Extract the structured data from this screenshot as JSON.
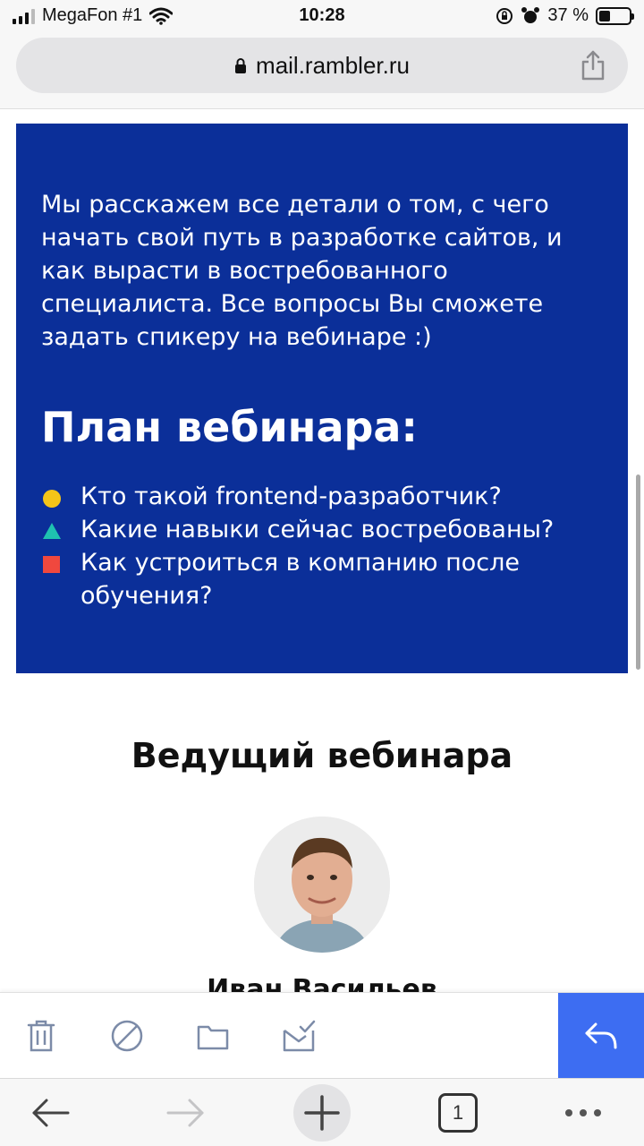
{
  "status_bar": {
    "carrier": "MegaFon #1",
    "time": "10:28",
    "battery_text": "37 %",
    "battery_level_percent": 37
  },
  "browser": {
    "url": "mail.rambler.ru"
  },
  "email": {
    "intro_text": "Мы расскажем все детали о том, с чего начать свой путь в разработке сайтов, и как вырасти в востребованного специалиста. Все вопросы Вы сможете задать спикеру на вебинаре :)",
    "plan_title": "План вебинара:",
    "plan_items": [
      {
        "text": "Кто такой frontend-разработчик?",
        "bullet": "yellow-circle",
        "color": "#f5c518"
      },
      {
        "text": "Какие навыки сейчас востребованы?",
        "bullet": "teal-triangle",
        "color": "#1fc2b0"
      },
      {
        "text": "Как устроиться в компанию после обучения?",
        "bullet": "red-square",
        "color": "#f0483e"
      }
    ],
    "host_section_title": "Ведущий вебинара",
    "host_name": "Иван Васильев",
    "banner_color": "#0b2f99"
  },
  "mail_toolbar": {
    "icons": [
      "trash-icon",
      "spam-block-icon",
      "folder-icon",
      "mark-read-icon"
    ],
    "reply_icon": "reply-icon",
    "reply_color": "#3d6df2"
  },
  "nav_bar": {
    "icons": [
      "back-arrow-icon",
      "forward-arrow-icon",
      "new-tab-plus-icon",
      "tabs-icon",
      "more-icon"
    ],
    "tab_count": "1"
  }
}
